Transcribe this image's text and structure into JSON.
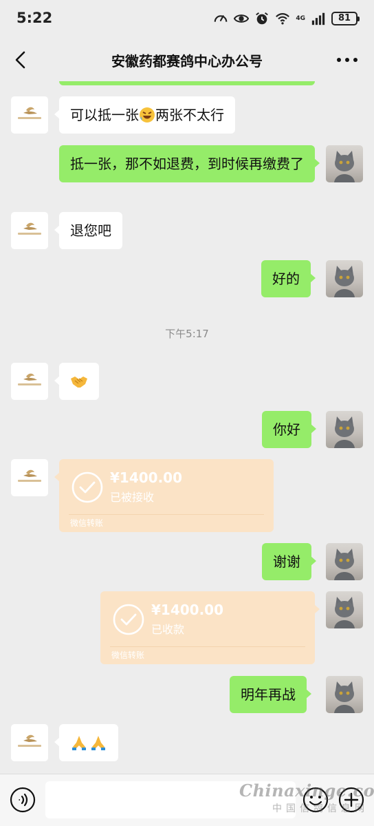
{
  "status_bar": {
    "time": "5:22",
    "network": "4G",
    "battery": "81",
    "icons": [
      "speedometer-icon",
      "eye-icon",
      "alarm-icon",
      "wifi-icon",
      "signal-icon",
      "battery-icon"
    ]
  },
  "header": {
    "title": "安徽药都赛鸽中心办公号",
    "back_icon": "back-arrow-icon",
    "more_icon": "more-dots-icon"
  },
  "colors": {
    "background": "#ededed",
    "outgoing_bubble": "#95ec69",
    "incoming_bubble": "#ffffff",
    "transfer_card": "#fbe3c6",
    "timestamp": "#8a8a8a"
  },
  "messages": [
    {
      "side": "in",
      "sender": "安徽药都赛鸽中心办公号",
      "text_before": "可以抵一张",
      "emoji": "rolling-on-floor-laughing",
      "text_after": "两张不太行"
    },
    {
      "side": "out",
      "text": "抵一张，那不如退费，到时候再缴费了"
    },
    {
      "side": "in",
      "text": "退您吧"
    },
    {
      "side": "out",
      "text": "好的"
    },
    {
      "side": "timestamp",
      "text": "下午5:17"
    },
    {
      "side": "in",
      "type": "emoji",
      "emoji": "handshake"
    },
    {
      "side": "out",
      "text": "你好"
    },
    {
      "side": "in",
      "type": "transfer",
      "amount": "¥1400.00",
      "status": "已被接收",
      "label": "微信转账"
    },
    {
      "side": "out",
      "text": "谢谢"
    },
    {
      "side": "out",
      "type": "transfer",
      "amount": "¥1400.00",
      "status": "已收款",
      "label": "微信转账"
    },
    {
      "side": "out",
      "text": "明年再战"
    },
    {
      "side": "in",
      "type": "emoji",
      "emoji": "folded-hands-twice"
    }
  ],
  "input_bar": {
    "placeholder": "",
    "value": "",
    "voice_icon": "voice-icon",
    "emoji_icon": "emoji-icon",
    "plus_icon": "plus-icon"
  },
  "watermark": {
    "text": "Chinaxinge.com",
    "subtext": "中国信鸽信息网"
  }
}
